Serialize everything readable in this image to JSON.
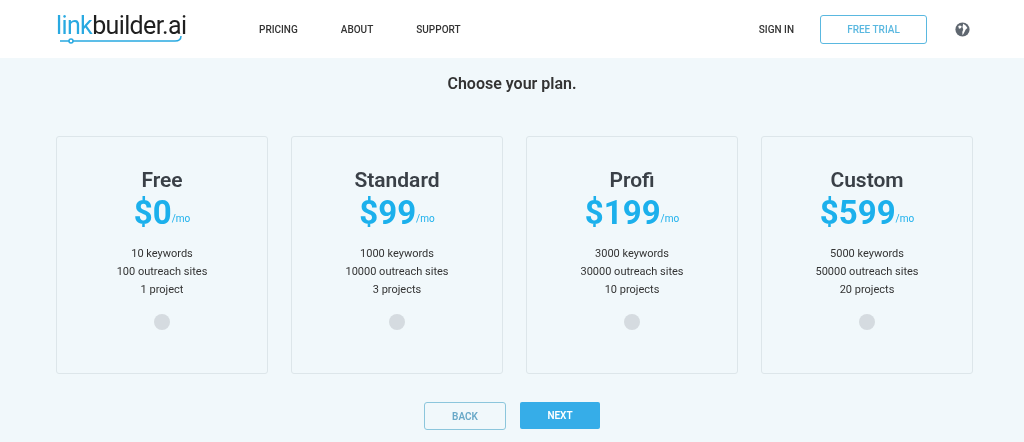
{
  "header": {
    "logo": {
      "accent": "link",
      "rest": "builder.ai"
    },
    "nav": [
      "PRICING",
      "ABOUT",
      "SUPPORT"
    ],
    "sign_in": "SIGN IN",
    "free_trial": "FREE TRIAL"
  },
  "heading": "Choose your plan.",
  "plans": [
    {
      "name": "Free",
      "price": "$0",
      "period": "/mo",
      "features": [
        "10 keywords",
        "100 outreach sites",
        "1 project"
      ],
      "selected": false
    },
    {
      "name": "Standard",
      "price": "$99",
      "period": "/mo",
      "features": [
        "1000 keywords",
        "10000 outreach sites",
        "3 projects"
      ],
      "selected": false
    },
    {
      "name": "Profi",
      "price": "$199",
      "period": "/mo",
      "features": [
        "3000 keywords",
        "30000 outreach sites",
        "10 projects"
      ],
      "selected": false
    },
    {
      "name": "Custom",
      "price": "$599",
      "period": "/mo",
      "features": [
        "5000 keywords",
        "50000 outreach sites",
        "20 projects"
      ],
      "selected": false
    }
  ],
  "buttons": {
    "back": "BACK",
    "next": "NEXT"
  }
}
